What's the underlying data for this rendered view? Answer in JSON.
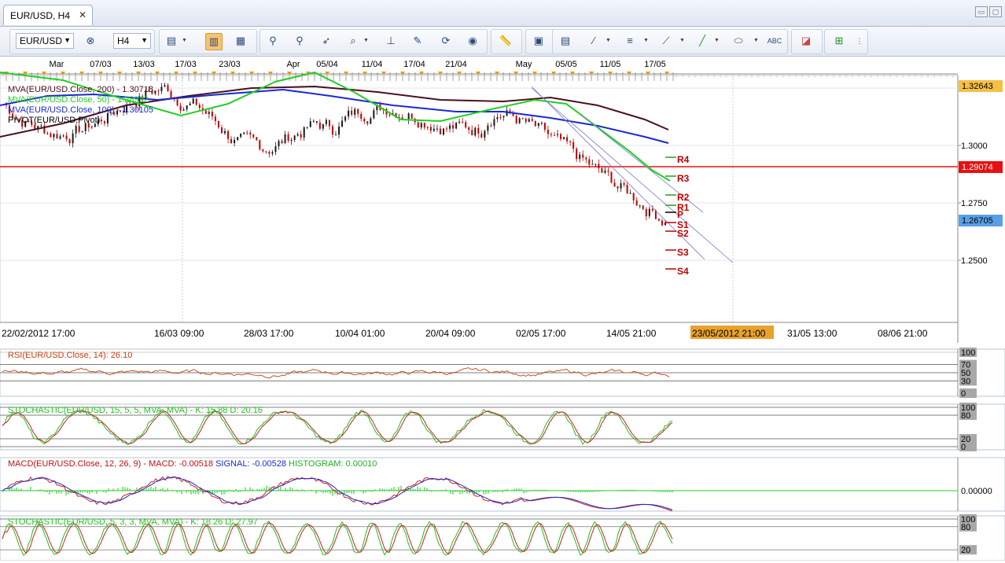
{
  "tab": {
    "title": "EUR/USD, H4",
    "close": "✕"
  },
  "window_buttons": [
    "▭",
    "▢"
  ],
  "toolbar": {
    "symbol": "EUR/USD",
    "timeframe": "H4"
  },
  "top_dates": [
    "Mar",
    "07/03",
    "13/03",
    "17/03",
    "23/03",
    "Apr",
    "05/04",
    "11/04",
    "17/04",
    "21/04",
    "May",
    "05/05",
    "11/05",
    "17/05"
  ],
  "price_axis": {
    "ticks": [
      "1.3000",
      "1.2750",
      "1.2500"
    ],
    "markers": [
      {
        "label": "1.32643",
        "bg": "#f5c044",
        "fg": "#000000"
      },
      {
        "label": "1.29074",
        "bg": "#e81010",
        "fg": "#ffffff"
      },
      {
        "label": "1.26705",
        "bg": "#5aa0e6",
        "fg": "#000000"
      }
    ]
  },
  "legend": [
    {
      "text": "MVA(EUR/USD.Close, 200) - 1.30718",
      "color": "#4b1020"
    },
    {
      "text": "MVA(EUR/USD.Close, 50) - 1.28922",
      "color": "#20d020"
    },
    {
      "text": "MVA(EUR/USD.Close, 100) - 1.30105",
      "color": "#1a2ad0"
    },
    {
      "text": "PIVOT(EUR/USD,Pivot)",
      "color": "#000000"
    }
  ],
  "pivots": [
    "R4",
    "R3",
    "R2",
    "R1",
    "P",
    "S1",
    "S2",
    "S3",
    "S4"
  ],
  "time_axis": {
    "labels": [
      "22/02/2012 17:00",
      "16/03 09:00",
      "28/03 17:00",
      "10/04 01:00",
      "20/04 09:00",
      "02/05 17:00",
      "14/05 21:00",
      "31/05 13:00",
      "08/06 21:00"
    ],
    "highlight": "23/05/2012 21:00"
  },
  "panels": {
    "rsi": {
      "title": "RSI(EUR/USD.Close, 14): 26.10",
      "color": "#c84010",
      "ticks": [
        "100",
        "70",
        "50",
        "30",
        "0"
      ]
    },
    "stoch1": {
      "title": "STOCHASTIC(EUR/USD, 15, 5, 5, MVA, MVA) -  K: 15.88  D: 20.16",
      "color": "#20c020",
      "ticks": [
        "100",
        "80",
        "20",
        "0"
      ]
    },
    "macd": {
      "title_prefix": "MACD(EUR/USD.Close, 12, 26, 9) -  ",
      "macd": "MACD: -0.00518",
      "signal": "SIGNAL: -0.00528",
      "histogram": "HISTOGRAM: 0.00010",
      "tick": "0.00000"
    },
    "stoch2": {
      "title": "STOCHASTIC(EUR/USD, 5, 3, 3, MVA, MVA) -  K: 18.26  D: 27.97",
      "color": "#20c020",
      "ticks": [
        "100",
        "80",
        "20"
      ]
    }
  }
}
